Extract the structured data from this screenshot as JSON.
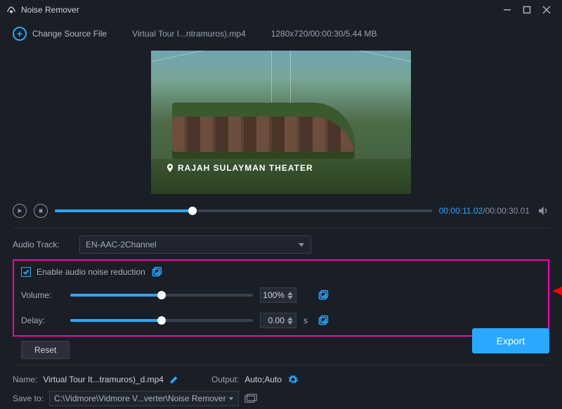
{
  "window": {
    "title": "Noise Remover"
  },
  "toolbar": {
    "change_source_label": "Change Source File",
    "filename": "Virtual Tour I...ntramuros).mp4",
    "fileinfo": "1280x720/00:00:30/5.44 MB"
  },
  "preview": {
    "caption": "RAJAH SULAYMAN THEATER"
  },
  "playbar": {
    "current": "00:00:11.02",
    "total": "00:00:30.01"
  },
  "audio_track": {
    "label": "Audio Track:",
    "value": "EN-AAC-2Channel"
  },
  "noise": {
    "enable_label": "Enable audio noise reduction",
    "volume_label": "Volume:",
    "volume_value": "100%",
    "delay_label": "Delay:",
    "delay_value": "0.00",
    "delay_unit": "s"
  },
  "buttons": {
    "reset": "Reset",
    "export": "Export"
  },
  "footer": {
    "name_label": "Name:",
    "name_value": "Virtual Tour It...tramuros)_d.mp4",
    "output_label": "Output:",
    "output_value": "Auto;Auto",
    "save_label": "Save to:",
    "save_path": "C:\\Vidmore\\Vidmore V...verter\\Noise Remover"
  }
}
